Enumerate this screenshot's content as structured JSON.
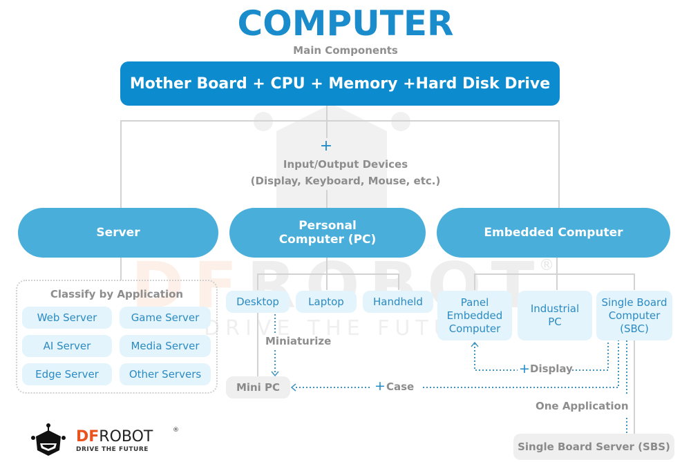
{
  "colors": {
    "title": "#1a8ccc",
    "top_box": "#0c8ccf",
    "category": "#4aaedb",
    "sub_item_bg": "#e3f4fc",
    "sub_item_text": "#2b8ac2",
    "connector_solid": "#d2d2d2",
    "connector_dotted": "#3d93c0",
    "logo_orange": "#e8531e"
  },
  "header": {
    "title": "COMPUTER",
    "subtitle": "Main Components"
  },
  "core": {
    "label": "Mother Board + CPU + Memory +Hard Disk Drive"
  },
  "io": {
    "plus": "+",
    "line1": "Input/Output Devices",
    "line2": "(Display, Keyboard, Mouse, etc.)"
  },
  "categories": [
    {
      "label": "Server"
    },
    {
      "label": "Personal Computer (PC)"
    },
    {
      "label": "Embedded Computer"
    }
  ],
  "server": {
    "classify_title": "Classify by Application",
    "types": [
      "Web Server",
      "Game Server",
      "AI Server",
      "Media Server",
      "Edge Server",
      "Other Servers"
    ]
  },
  "pc": {
    "types": [
      "Desktop",
      "Laptop",
      "Handheld"
    ],
    "miniaturize_label": "Miniaturize",
    "mini_pc": "Mini PC"
  },
  "embedded": {
    "types": [
      "Panel Embedded Computer",
      "Industrial PC",
      "Single Board Computer (SBC)"
    ],
    "display_plus": "+",
    "display_label": "Display",
    "case_plus": "+",
    "case_label": "Case",
    "one_app_label": "One Application",
    "sbs": "Single Board Server (SBS)"
  },
  "watermark": {
    "brand": "DFROBOT",
    "registered": "®",
    "tagline": "DRIVE THE FUTURE"
  },
  "logo": {
    "brand_df": "DF",
    "brand_robot": "ROBOT",
    "registered": "®",
    "tagline": "DRIVE THE FUTURE"
  }
}
